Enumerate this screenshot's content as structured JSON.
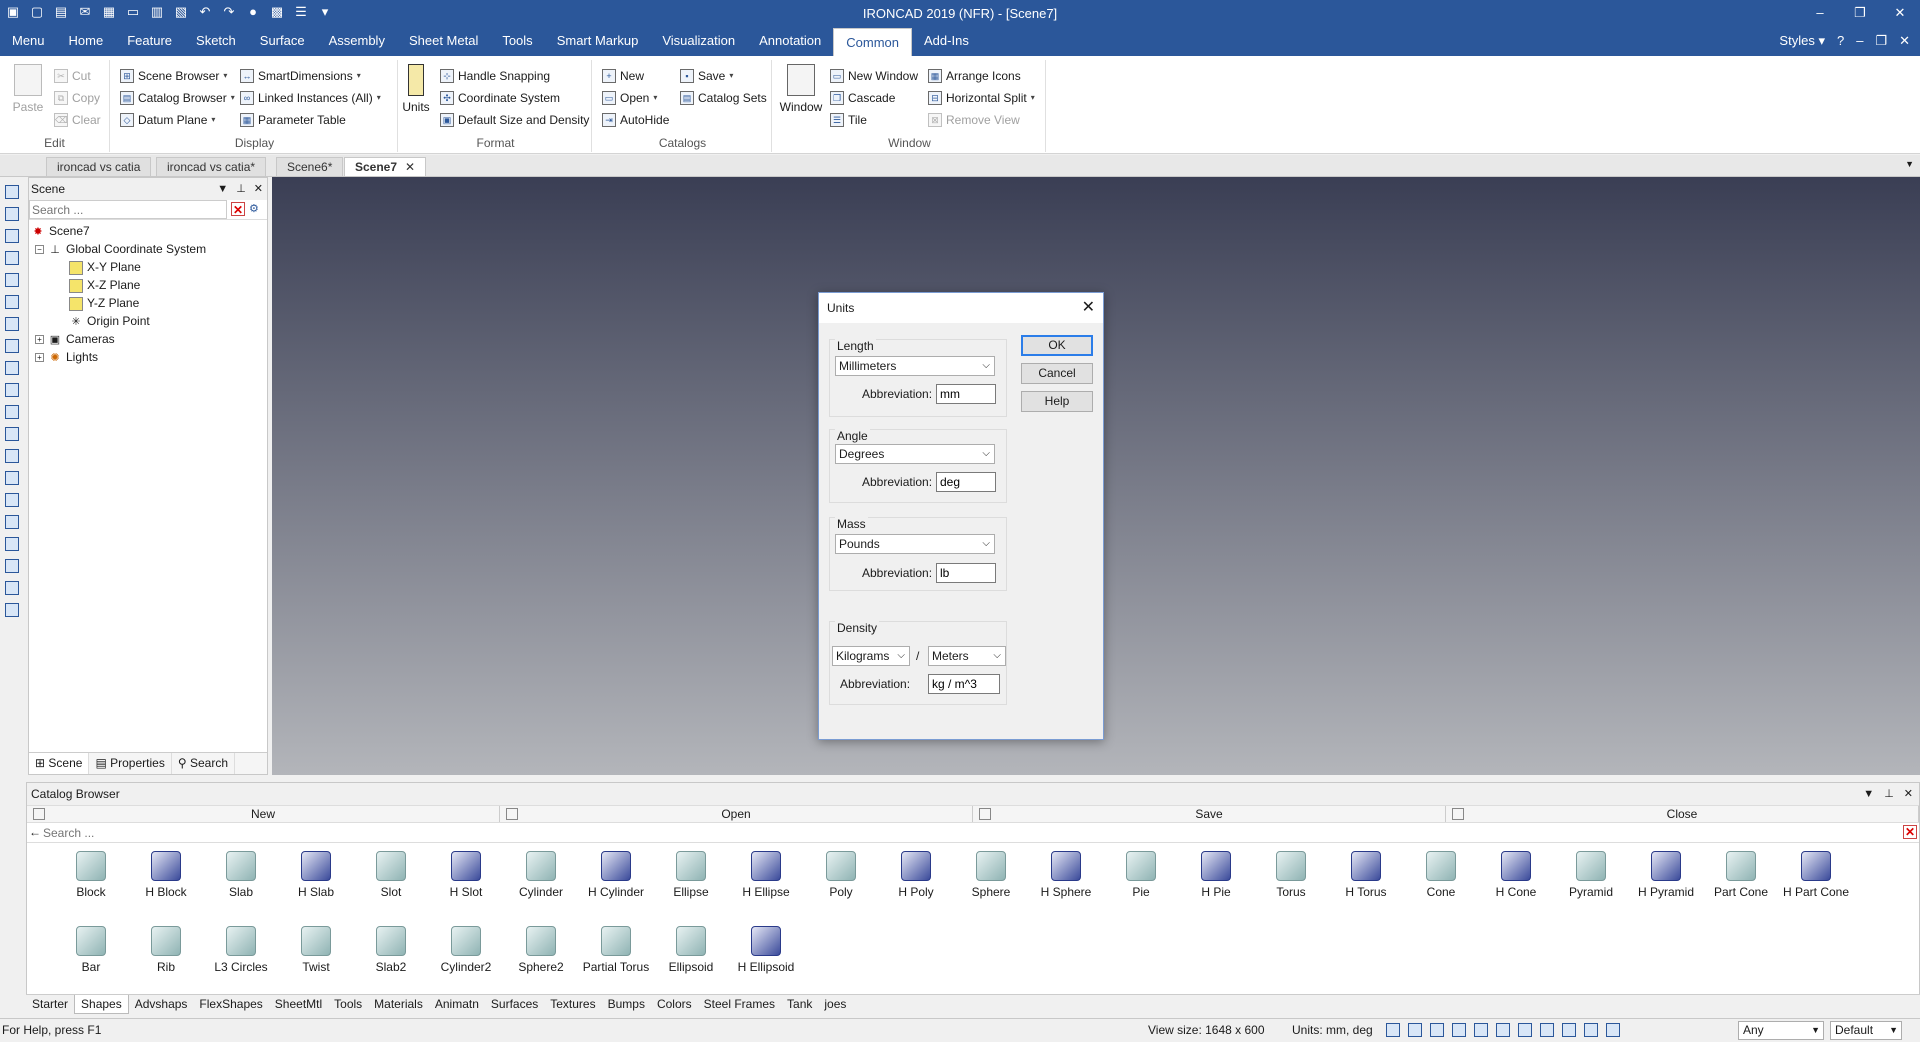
{
  "window": {
    "title": "IRONCAD 2019 (NFR) - [Scene7]"
  },
  "menubar": {
    "tabs": [
      "Menu",
      "Home",
      "Feature",
      "Sketch",
      "Surface",
      "Assembly",
      "Sheet Metal",
      "Tools",
      "Smart Markup",
      "Visualization",
      "Annotation",
      "Common",
      "Add-Ins"
    ],
    "active_tab": "Common",
    "styles_label": "Styles"
  },
  "ribbon": {
    "edit": {
      "label": "Edit",
      "paste": "Paste",
      "cut": "Cut",
      "copy": "Copy",
      "clear": "Clear"
    },
    "display": {
      "label": "Display",
      "scene_browser": "Scene Browser",
      "catalog_browser": "Catalog Browser",
      "datum_plane": "Datum Plane",
      "smart_dimensions": "SmartDimensions",
      "linked_instances": "Linked Instances (All)",
      "parameter_table": "Parameter Table"
    },
    "format": {
      "label": "Format",
      "units": "Units",
      "handle_snapping": "Handle Snapping",
      "coordinate_system": "Coordinate System",
      "default_size_density": "Default Size and Density"
    },
    "catalogs": {
      "label": "Catalogs",
      "new": "New",
      "open": "Open",
      "autohide": "AutoHide",
      "save": "Save",
      "catalog_sets": "Catalog Sets"
    },
    "window": {
      "label": "Window",
      "window": "Window",
      "new_window": "New Window",
      "cascade": "Cascade",
      "tile": "Tile",
      "arrange_icons": "Arrange Icons",
      "horizontal_split": "Horizontal Split",
      "remove_view": "Remove View"
    }
  },
  "doc_tabs": [
    {
      "label": "ironcad vs catia"
    },
    {
      "label": "ironcad vs catia*"
    },
    {
      "label": "Scene6*"
    },
    {
      "label": "Scene7"
    }
  ],
  "scene_panel": {
    "title": "Scene",
    "search_placeholder": "Search ...",
    "tree": {
      "root": "Scene7",
      "gcs": "Global Coordinate System",
      "xy": "X-Y Plane",
      "xz": "X-Z Plane",
      "yz": "Y-Z Plane",
      "origin": "Origin Point",
      "cameras": "Cameras",
      "lights": "Lights"
    },
    "footer_tabs": [
      "Scene",
      "Properties",
      "Search"
    ]
  },
  "units_dialog": {
    "title": "Units",
    "ok": "OK",
    "cancel": "Cancel",
    "help": "Help",
    "abbreviation_label": "Abbreviation:",
    "length": {
      "legend": "Length",
      "value": "Millimeters",
      "abbr": "mm"
    },
    "angle": {
      "legend": "Angle",
      "value": "Degrees",
      "abbr": "deg"
    },
    "mass": {
      "legend": "Mass",
      "value": "Pounds",
      "abbr": "lb"
    },
    "density": {
      "legend": "Density",
      "mass_unit": "Kilograms",
      "separator": "/",
      "length_unit": "Meters",
      "abbr": "kg / m^3"
    }
  },
  "catalog": {
    "title": "Catalog Browser",
    "buttons": [
      "New",
      "Open",
      "Save",
      "Close"
    ],
    "search_placeholder": "Search ...",
    "shapes_row1": [
      "Block",
      "H Block",
      "Slab",
      "H Slab",
      "Slot",
      "H Slot",
      "Cylinder",
      "H Cylinder",
      "Ellipse",
      "H Ellipse",
      "Poly",
      "H Poly",
      "Sphere",
      "H Sphere",
      "Pie",
      "H Pie",
      "Torus",
      "H Torus",
      "Cone",
      "H Cone",
      "Pyramid",
      "H Pyramid",
      "Part Cone",
      "H Part Cone"
    ],
    "shapes_row2": [
      "Bar",
      "Rib",
      "L3 Circles",
      "Twist",
      "Slab2",
      "Cylinder2",
      "Sphere2",
      "Partial Torus",
      "Ellipsoid",
      "H Ellipsoid"
    ],
    "tabs": [
      "Starter",
      "Shapes",
      "Advshaps",
      "FlexShapes",
      "SheetMtl",
      "Tools",
      "Materials",
      "Animatn",
      "Surfaces",
      "Textures",
      "Bumps",
      "Colors",
      "Steel Frames",
      "Tank",
      "joes"
    ],
    "active_tab": "Shapes"
  },
  "status": {
    "help_text": "For Help, press F1",
    "view_size": "View size: 1648 x 600",
    "units": "Units: mm, deg",
    "filter": "Any",
    "style": "Default"
  }
}
